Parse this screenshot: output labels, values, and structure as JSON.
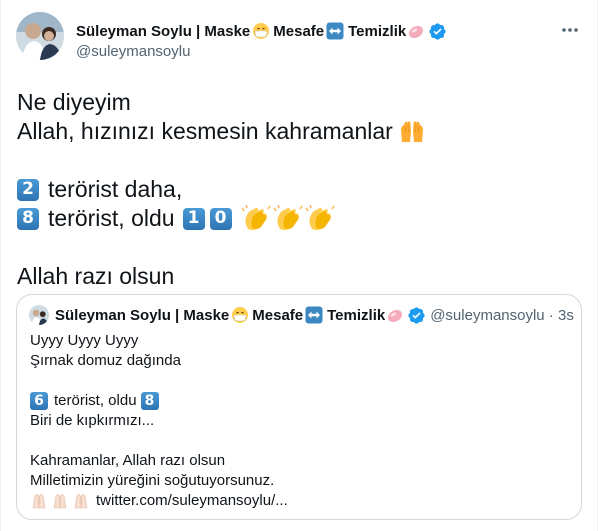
{
  "tweet": {
    "author_name": "Süleyman Soylu | Maske",
    "name_word_2": "Mesafe",
    "name_word_3": "Temizlik",
    "handle": "@suleymansoylu",
    "line1": "Ne diyeyim",
    "line2": "Allah, hızınızı kesmesin kahramanlar",
    "line3_key": "2",
    "line3_text": "terörist daha,",
    "line4_key": "8",
    "line4_text": "terörist, oldu",
    "line4_key2": "1",
    "line4_key3": "0",
    "line5": "Allah razı olsun"
  },
  "quote": {
    "author_name": "Süleyman Soylu | Maske",
    "name_word_2": "Mesafe",
    "name_word_3": "Temizlik",
    "handle_time": "@suleymansoylu · 3s",
    "line1": "Uyyy Uyyy Uyyy",
    "line2": "Şırnak domuz dağında",
    "line3_key": "6",
    "line3_text": "terörist, oldu",
    "line3_key2": "8",
    "line4": "Biri de kıpkırmızı...",
    "line5": "Kahramanlar, Allah razı olsun",
    "line6": "Milletimizin yüreğini soğutuyorsunuz.",
    "line7": "twitter.com/suleymansoylu/..."
  },
  "icons": [
    "mask-face-icon",
    "left-right-arrow-icon",
    "soap-icon",
    "verified-badge-icon",
    "more-options-icon",
    "raising-hands-icon",
    "clapping-hands-icon"
  ],
  "colors": {
    "text": "#0f1419",
    "muted": "#536471",
    "verified": "#1d9bf0",
    "keycap": "#3b88c3",
    "border": "#cfd9de"
  }
}
